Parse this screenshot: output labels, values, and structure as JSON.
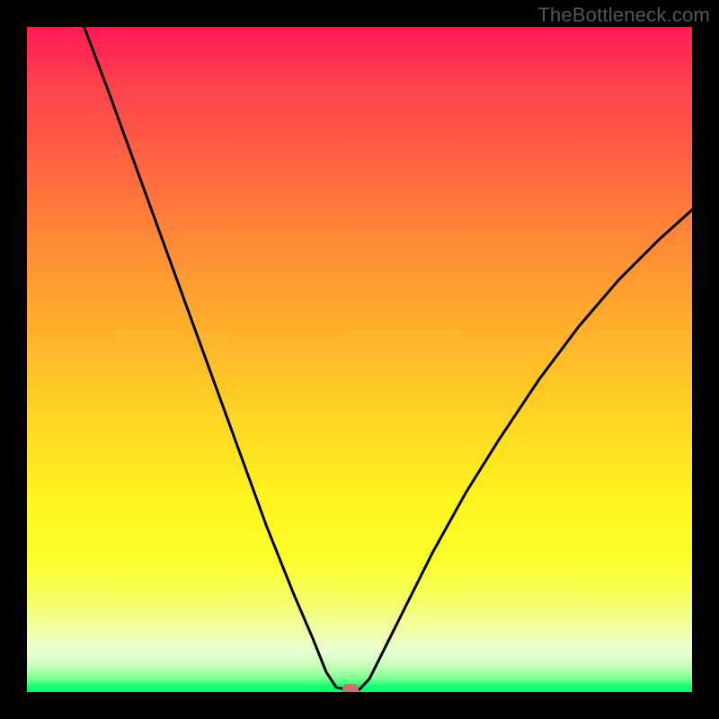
{
  "watermark": "TheBottleneck.com",
  "marker": {
    "x_frac": 0.4865,
    "y_frac": 0.996
  },
  "colors": {
    "curve": "#000000",
    "marker": "#cc6f6e",
    "gradient_top": "#ff1a54",
    "gradient_mid": "#ffe81f",
    "gradient_bottom": "#00ff66"
  },
  "chart_data": {
    "type": "line",
    "title": "",
    "xlabel": "",
    "ylabel": "",
    "xlim": [
      0,
      1
    ],
    "ylim": [
      0,
      1
    ],
    "note": "Chart has no visible axis tick labels. Curve points and marker are given as fractional x,y within the plot area (0,0 = top-left, 1,1 = bottom-right). The curve descends steeply from the top-left to a minimum at x≈0.49 then rises toward the right edge at mid-height.",
    "series": [
      {
        "name": "bottleneck-curve",
        "points": [
          {
            "x": 0.086,
            "y": 0.0
          },
          {
            "x": 0.12,
            "y": 0.09
          },
          {
            "x": 0.16,
            "y": 0.2
          },
          {
            "x": 0.2,
            "y": 0.31
          },
          {
            "x": 0.24,
            "y": 0.42
          },
          {
            "x": 0.28,
            "y": 0.53
          },
          {
            "x": 0.32,
            "y": 0.64
          },
          {
            "x": 0.36,
            "y": 0.75
          },
          {
            "x": 0.4,
            "y": 0.85
          },
          {
            "x": 0.43,
            "y": 0.92
          },
          {
            "x": 0.45,
            "y": 0.97
          },
          {
            "x": 0.465,
            "y": 0.993
          },
          {
            "x": 0.48,
            "y": 0.996
          },
          {
            "x": 0.5,
            "y": 0.996
          },
          {
            "x": 0.515,
            "y": 0.98
          },
          {
            "x": 0.54,
            "y": 0.93
          },
          {
            "x": 0.57,
            "y": 0.87
          },
          {
            "x": 0.61,
            "y": 0.79
          },
          {
            "x": 0.66,
            "y": 0.7
          },
          {
            "x": 0.71,
            "y": 0.62
          },
          {
            "x": 0.77,
            "y": 0.53
          },
          {
            "x": 0.83,
            "y": 0.45
          },
          {
            "x": 0.89,
            "y": 0.38
          },
          {
            "x": 0.95,
            "y": 0.32
          },
          {
            "x": 1.0,
            "y": 0.275
          }
        ]
      }
    ],
    "marker_point": {
      "x": 0.4865,
      "y": 0.996
    }
  }
}
